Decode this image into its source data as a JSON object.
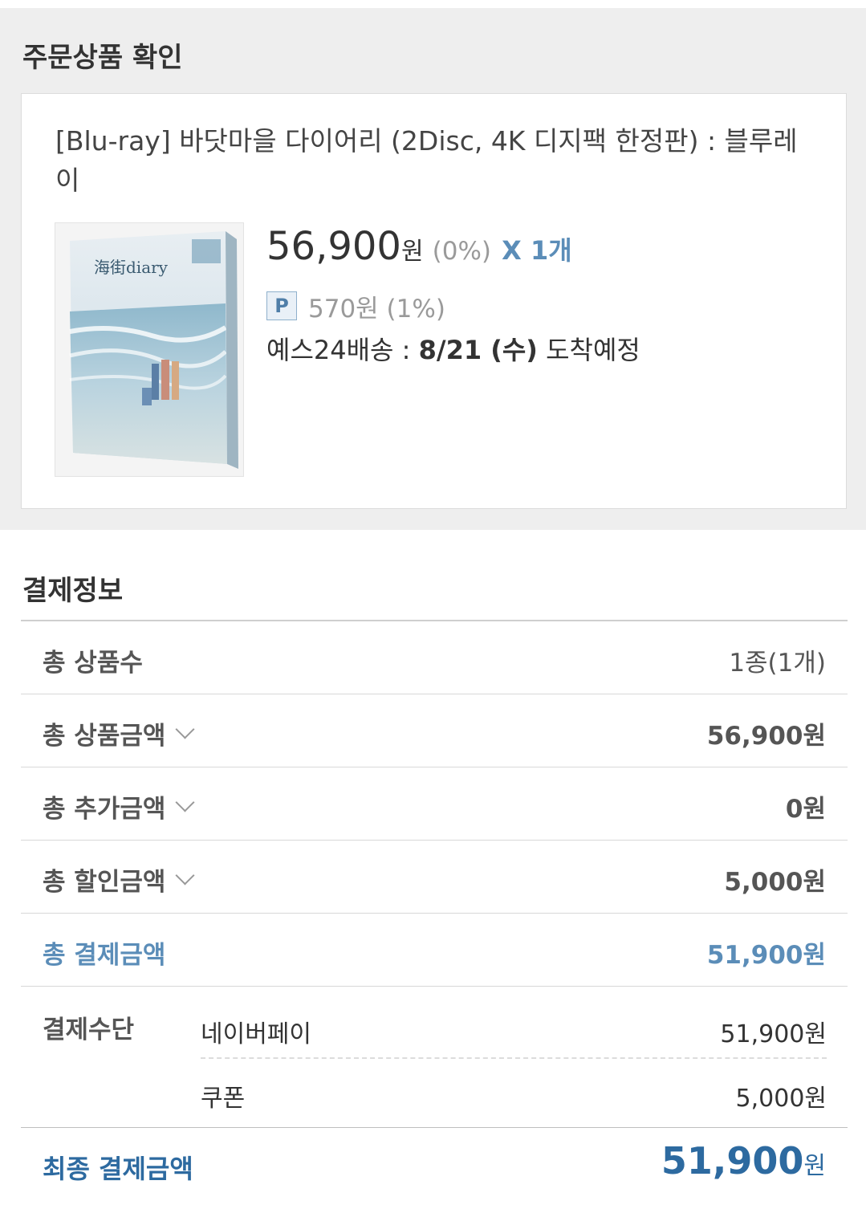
{
  "order_section": {
    "title": "주문상품 확인",
    "product": {
      "name": "[Blu-ray] 바닷마을 다이어리 (2Disc, 4K 디지팩 한정판) : 블루레이",
      "price": "56,900",
      "price_unit": "원",
      "discount_rate": "(0%)",
      "quantity": "X 1개",
      "point_badge": "P",
      "point_text": "570원 (1%)",
      "delivery_prefix": "예스24배송 : ",
      "delivery_date": "8/21 (수)",
      "delivery_suffix": " 도착예정",
      "thumbnail_title": "海街diary"
    }
  },
  "payment_section": {
    "title": "결제정보",
    "rows": [
      {
        "label": "총 상품수",
        "value": "1종(1개)"
      },
      {
        "label": "총 상품금액",
        "value": "56,900원"
      },
      {
        "label": "총 추가금액",
        "value": "0원"
      },
      {
        "label": "총 할인금액",
        "value": "5,000원"
      },
      {
        "label": "총 결제금액",
        "value": "51,900원"
      }
    ],
    "method": {
      "label": "결제수단",
      "items": [
        {
          "name": "네이버페이",
          "value": "51,900원"
        },
        {
          "name": "쿠폰",
          "value": "5,000원"
        }
      ]
    },
    "final": {
      "label": "최종 결제금액",
      "amount": "51,900",
      "unit": "원"
    }
  },
  "colors": {
    "accent_blue": "#5b8db8",
    "final_blue": "#2d6aa0",
    "section_bg": "#eeeeee"
  },
  "icons": [
    "chevron-down-icon",
    "point-badge-icon"
  ]
}
